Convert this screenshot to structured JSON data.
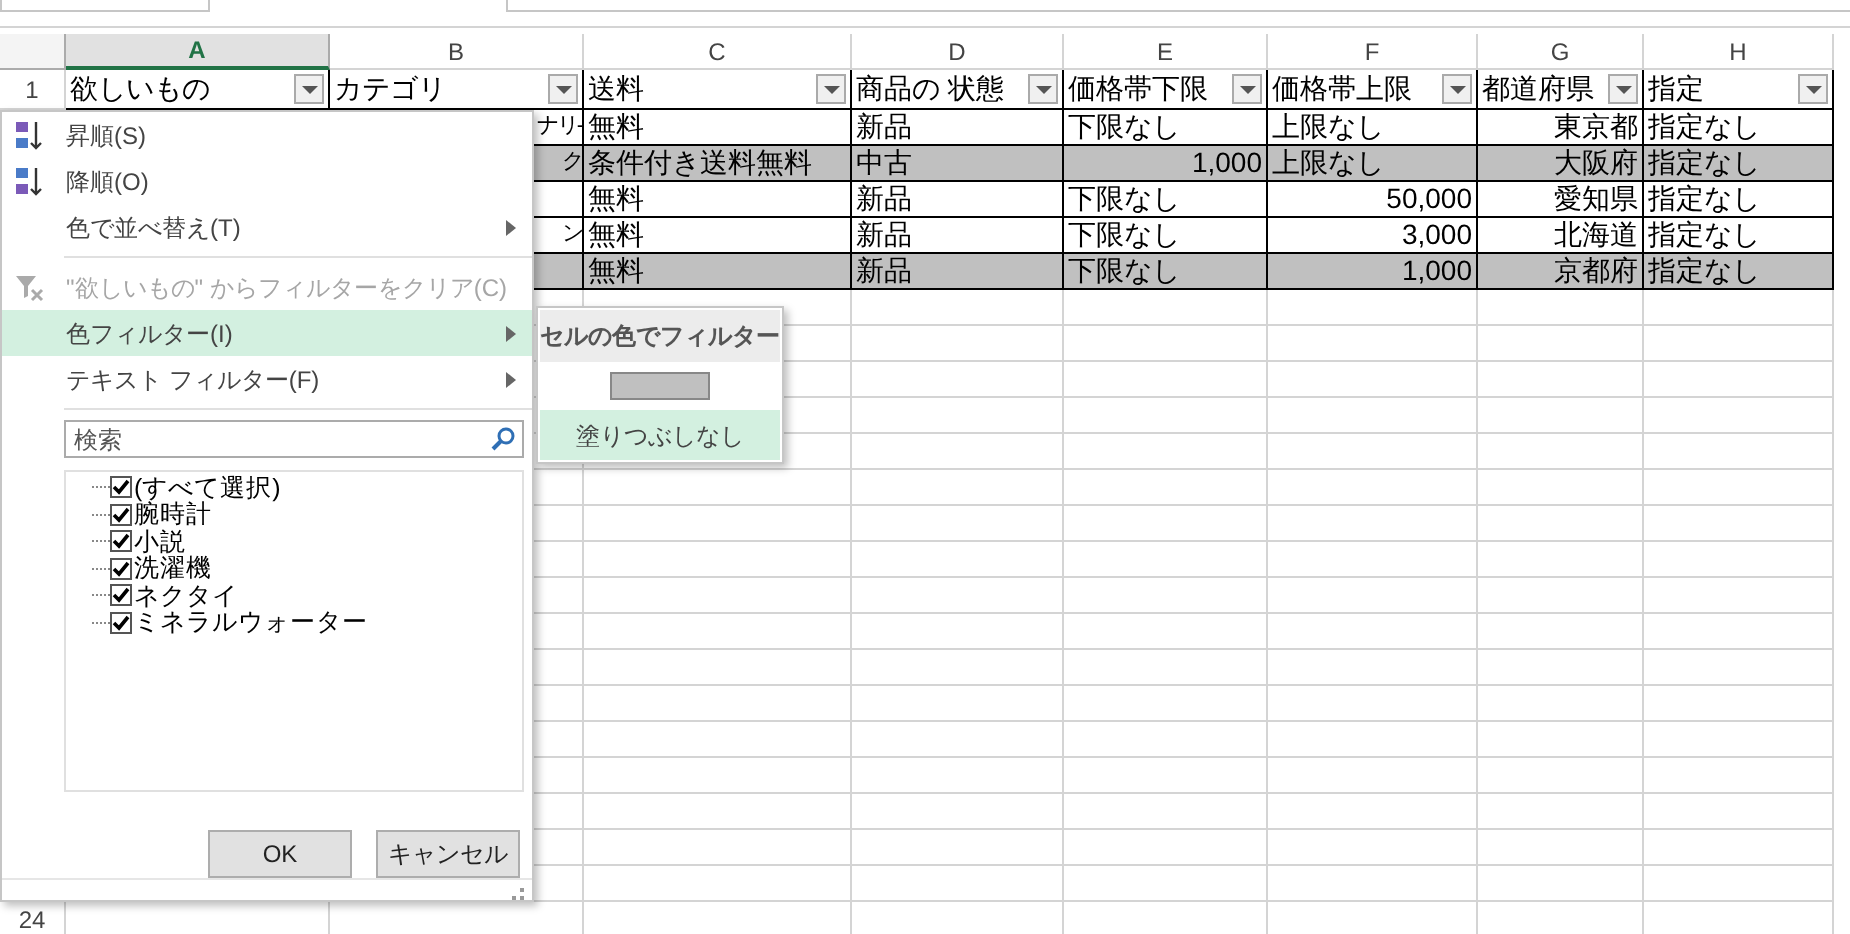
{
  "columns": [
    {
      "letter": "A",
      "selected": true
    },
    {
      "letter": "B",
      "selected": false
    },
    {
      "letter": "C",
      "selected": false
    },
    {
      "letter": "D",
      "selected": false
    },
    {
      "letter": "E",
      "selected": false
    },
    {
      "letter": "F",
      "selected": false
    },
    {
      "letter": "G",
      "selected": false
    },
    {
      "letter": "H",
      "selected": false
    }
  ],
  "header_row": {
    "number": "1",
    "cells": [
      "欲しいもの",
      "カテゴリ",
      "送料",
      "商品の 状態",
      "価格帯下限",
      "価格帯上限",
      "都道府県",
      "指定"
    ]
  },
  "rows": [
    {
      "shaded": false,
      "cells": [
        "",
        "ナリ-",
        "無料",
        "新品",
        "下限なし",
        "上限なし",
        "東京都",
        "指定なし"
      ]
    },
    {
      "shaded": true,
      "cells": [
        "",
        "ク",
        "条件付き送料無料",
        "中古",
        "1,000",
        "上限なし",
        "大阪府",
        "指定なし"
      ]
    },
    {
      "shaded": false,
      "cells": [
        "",
        "",
        "無料",
        "新品",
        "下限なし",
        "50,000",
        "愛知県",
        "指定なし"
      ]
    },
    {
      "shaded": false,
      "cells": [
        "",
        "ン",
        "無料",
        "新品",
        "下限なし",
        "3,000",
        "北海道",
        "指定なし"
      ]
    },
    {
      "shaded": true,
      "cells": [
        "",
        "",
        "無料",
        "新品",
        "下限なし",
        "1,000",
        "京都府",
        "指定なし"
      ]
    }
  ],
  "last_row_number": "24",
  "menu": {
    "items": [
      {
        "kind": "sort_asc",
        "label": "昇順(S)",
        "disabled": false,
        "selected": false,
        "submenu": false
      },
      {
        "kind": "sort_desc",
        "label": "降順(O)",
        "disabled": false,
        "selected": false,
        "submenu": false
      },
      {
        "kind": "plain",
        "label": "色で並べ替え(T)",
        "disabled": false,
        "selected": false,
        "submenu": true
      },
      {
        "kind": "clear",
        "label": "\"欲しいもの\" からフィルターをクリア(C)",
        "disabled": true,
        "selected": false,
        "submenu": false
      },
      {
        "kind": "plain",
        "label": "色フィルター(I)",
        "disabled": false,
        "selected": true,
        "submenu": true
      },
      {
        "kind": "plain",
        "label": "テキスト フィルター(F)",
        "disabled": false,
        "selected": false,
        "submenu": true
      }
    ],
    "search": {
      "placeholder": "検索"
    },
    "values": [
      {
        "label": "(すべて選択)",
        "checked": true
      },
      {
        "label": "腕時計",
        "checked": true
      },
      {
        "label": "小説",
        "checked": true
      },
      {
        "label": "洗濯機",
        "checked": true
      },
      {
        "label": "ネクタイ",
        "checked": true
      },
      {
        "label": "ミネラルウォーター",
        "checked": true
      }
    ],
    "buttons": [
      "OK",
      "キャンセル"
    ]
  },
  "submenu": {
    "title": "セルの色でフィルター",
    "swatches": [
      {
        "color": "#c0c0c0"
      }
    ],
    "no_fill": {
      "label": "塗りつぶしなし",
      "selected": true
    }
  }
}
